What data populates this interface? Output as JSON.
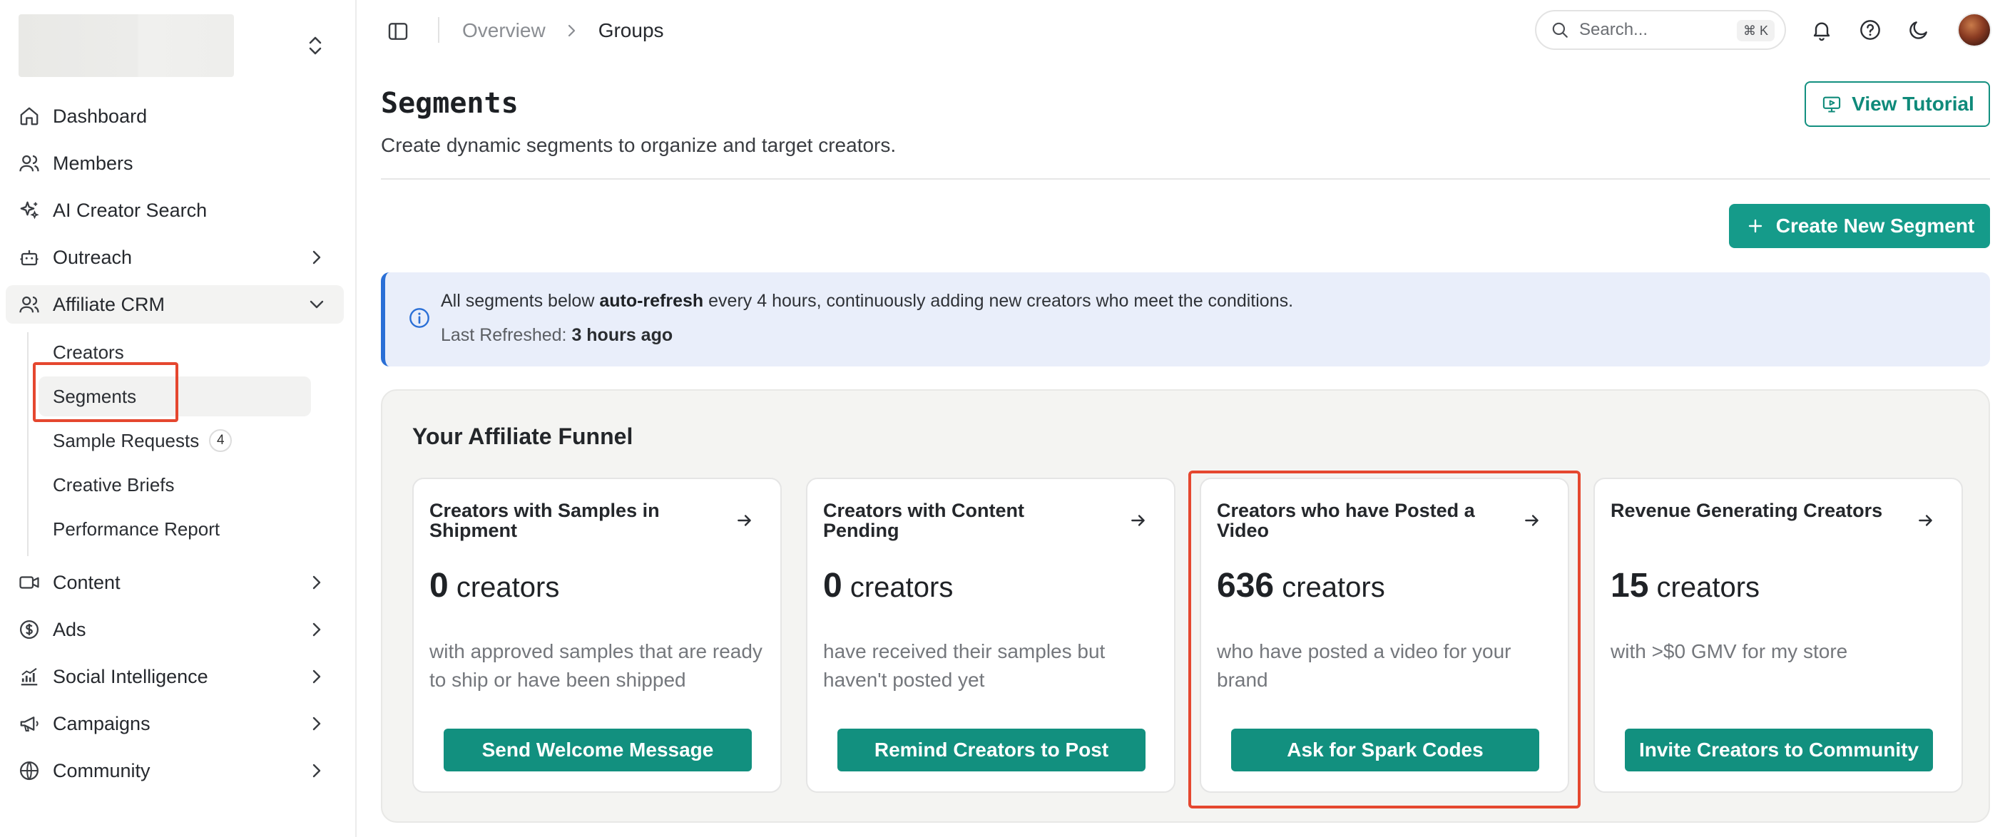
{
  "sidebar": {
    "items": [
      {
        "label": "Dashboard",
        "icon": "home-icon"
      },
      {
        "label": "Members",
        "icon": "users-icon"
      },
      {
        "label": "AI Creator Search",
        "icon": "sparkles-icon"
      },
      {
        "label": "Outreach",
        "icon": "bot-icon",
        "expandable": true
      },
      {
        "label": "Affiliate CRM",
        "icon": "users-icon",
        "expandable": true,
        "expanded": true
      },
      {
        "label": "Content",
        "icon": "video-icon",
        "expandable": true
      },
      {
        "label": "Ads",
        "icon": "dollar-icon",
        "expandable": true
      },
      {
        "label": "Social Intelligence",
        "icon": "chart-icon",
        "expandable": true
      },
      {
        "label": "Campaigns",
        "icon": "megaphone-icon",
        "expandable": true
      },
      {
        "label": "Community",
        "icon": "globe-icon",
        "expandable": true
      }
    ],
    "affiliate_sub": [
      {
        "label": "Creators"
      },
      {
        "label": "Segments",
        "active": true
      },
      {
        "label": "Sample Requests",
        "badge": "4"
      },
      {
        "label": "Creative Briefs"
      },
      {
        "label": "Performance Report"
      }
    ]
  },
  "topbar": {
    "breadcrumb": [
      "Overview",
      "Groups"
    ],
    "search_placeholder": "Search...",
    "search_shortcut": "⌘ K"
  },
  "page": {
    "title": "Segments",
    "subtitle": "Create dynamic segments to organize and target creators.",
    "tutorial_label": "View Tutorial",
    "create_label": "Create New Segment"
  },
  "info": {
    "line1_pre": "All segments below ",
    "line1_bold": "auto-refresh",
    "line1_post": " every 4 hours, continuously adding new creators who meet the conditions.",
    "line2_label": "Last Refreshed: ",
    "line2_value": "3 hours ago"
  },
  "funnel": {
    "title": "Your Affiliate Funnel",
    "cards": [
      {
        "title": "Creators with Samples in Shipment",
        "count": "0",
        "unit": "creators",
        "desc": "with approved samples that are ready to ship or have been shipped",
        "button": "Send Welcome Message"
      },
      {
        "title": "Creators with Content Pending",
        "count": "0",
        "unit": "creators",
        "desc": "have received their samples but haven't posted yet",
        "button": "Remind Creators to Post"
      },
      {
        "title": "Creators who have Posted a Video",
        "count": "636",
        "unit": "creators",
        "desc": "who have posted a video for your brand",
        "button": "Ask for Spark Codes"
      },
      {
        "title": "Revenue Generating Creators",
        "count": "15",
        "unit": "creators",
        "desc": "with >$0 GMV for my store",
        "button": "Invite Creators to Community"
      }
    ]
  },
  "colors": {
    "accent": "#12907f",
    "highlight": "#e5472f",
    "info_bg": "#e9eefa",
    "info_border": "#2a6fd6"
  }
}
